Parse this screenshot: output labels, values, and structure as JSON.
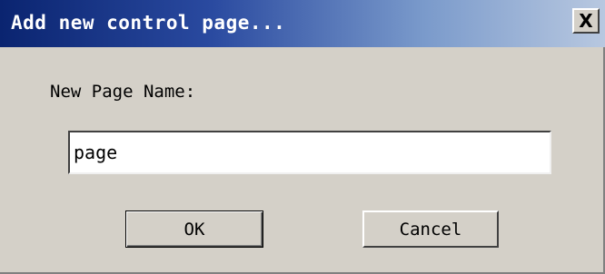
{
  "window": {
    "title": "Add new control page...",
    "close_label": "X"
  },
  "form": {
    "name_label": "New Page Name:",
    "name_value": "page"
  },
  "buttons": {
    "ok_label": "OK",
    "cancel_label": "Cancel"
  }
}
